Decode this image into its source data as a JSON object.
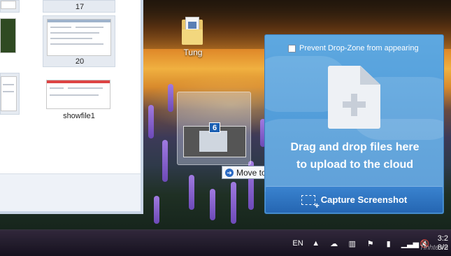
{
  "explorer": {
    "items": [
      {
        "label": "17"
      },
      {
        "label": ""
      },
      {
        "label": "20"
      },
      {
        "label": ""
      },
      {
        "label": "showfile1"
      }
    ]
  },
  "desktop": {
    "icon_label": "Tung"
  },
  "drag": {
    "count_badge": "6",
    "tooltip_label": "Move to Desktop",
    "tooltip_icon": "arrow-right-icon"
  },
  "dropzone": {
    "prevent_label": "Prevent Drop-Zone from appearing",
    "prevent_checked": false,
    "line1": "Drag and drop files here",
    "line2": "to upload to the cloud",
    "capture_label": "Capture Screenshot",
    "accent": "#4f9ad8"
  },
  "taskbar": {
    "language": "EN",
    "clock_time": "3:2",
    "clock_date": "8/2",
    "watermark": "Tinhte.vn"
  }
}
